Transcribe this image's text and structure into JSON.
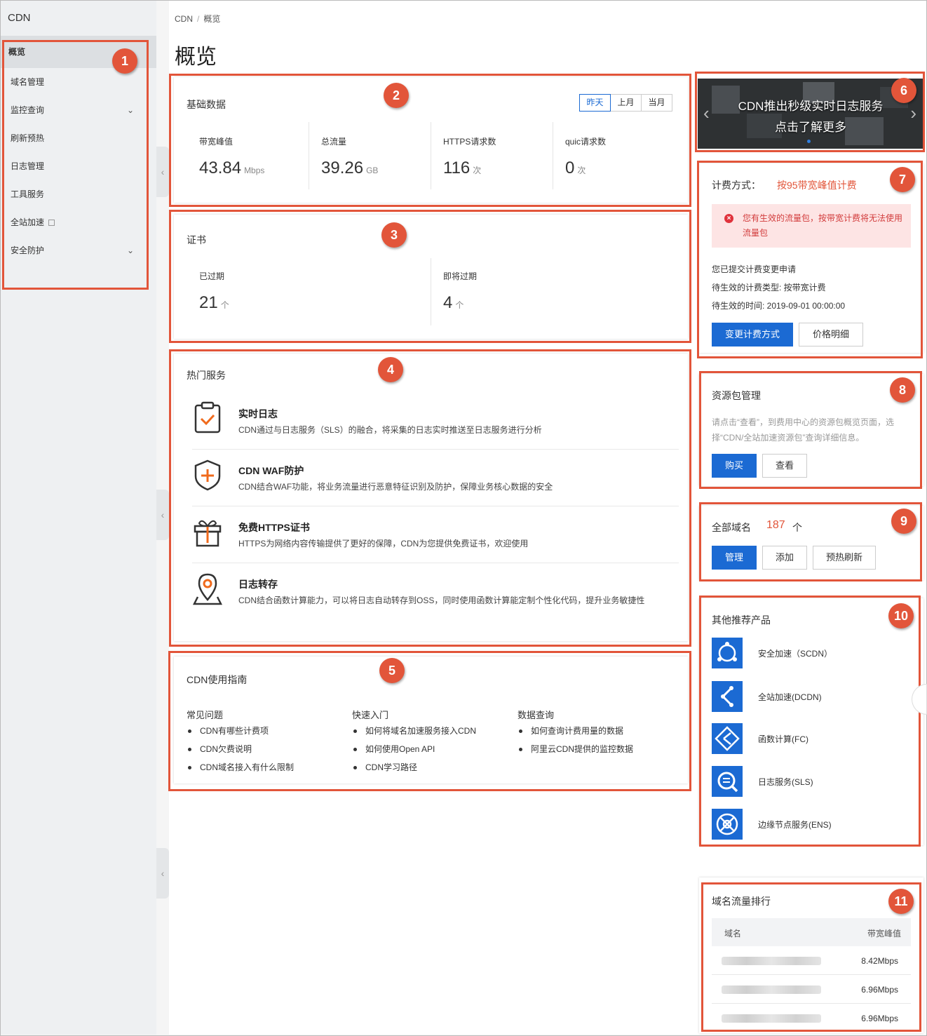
{
  "sidebar": {
    "brand": "CDN",
    "items": [
      {
        "label": "概览"
      },
      {
        "label": "域名管理"
      },
      {
        "label": "监控查询"
      },
      {
        "label": "刷新预热"
      },
      {
        "label": "日志管理"
      },
      {
        "label": "工具服务"
      },
      {
        "label": "全站加速"
      },
      {
        "label": "安全防护"
      }
    ]
  },
  "breadcrumb": {
    "root": "CDN",
    "sep": "/",
    "current": "概览"
  },
  "page_title": "概览",
  "badges": [
    "1",
    "2",
    "3",
    "4",
    "5",
    "6",
    "7",
    "8",
    "9",
    "10",
    "11"
  ],
  "basic": {
    "title": "基础数据",
    "ranges": [
      "昨天",
      "上月",
      "当月"
    ],
    "stats": [
      {
        "label": "带宽峰值",
        "value": "43.84",
        "unit": "Mbps"
      },
      {
        "label": "总流量",
        "value": "39.26",
        "unit": "GB"
      },
      {
        "label": "HTTPS请求数",
        "value": "116",
        "unit": "次"
      },
      {
        "label": "quic请求数",
        "value": "0",
        "unit": "次"
      }
    ]
  },
  "cert": {
    "title": "证书",
    "stats": [
      {
        "label": "已过期",
        "value": "21",
        "unit": "个"
      },
      {
        "label": "即将过期",
        "value": "4",
        "unit": "个"
      }
    ]
  },
  "hot": {
    "title": "热门服务",
    "items": [
      {
        "name": "实时日志",
        "desc": "CDN通过与日志服务（SLS）的融合，将采集的日志实时推送至日志服务进行分析",
        "icon": "clipboard-check-icon"
      },
      {
        "name": "CDN WAF防护",
        "desc": "CDN结合WAF功能，将业务流量进行恶意特征识别及防护，保障业务核心数据的安全",
        "icon": "shield-plus-icon"
      },
      {
        "name": "免费HTTPS证书",
        "desc": "HTTPS为网络内容传输提供了更好的保障，CDN为您提供免费证书，欢迎使用",
        "icon": "gift-icon"
      },
      {
        "name": "日志转存",
        "desc": "CDN结合函数计算能力，可以将日志自动转存到OSS，同时使用函数计算能定制个性化代码，提升业务敏捷性",
        "icon": "location-pin-icon"
      }
    ]
  },
  "guide": {
    "title": "CDN使用指南",
    "columns": [
      {
        "heading": "常见问题",
        "links": [
          "CDN有哪些计费项",
          "CDN欠费说明",
          "CDN域名接入有什么限制"
        ]
      },
      {
        "heading": "快速入门",
        "links": [
          "如何将域名加速服务接入CDN",
          "如何使用Open API",
          "CDN学习路径"
        ]
      },
      {
        "heading": "数据查询",
        "links": [
          "如何查询计费用量的数据",
          "阿里云CDN提供的监控数据"
        ]
      }
    ]
  },
  "banner": {
    "line1": "CDN推出秒级实时日志服务",
    "line2": "点击了解更多"
  },
  "billing": {
    "label": "计费方式：",
    "method": "按95带宽峰值计费",
    "alert": "您有生效的流量包，按带宽计费将无法使用流量包",
    "lines": [
      "您已提交计费变更申请",
      "待生效的计费类型: 按带宽计费",
      "待生效的时间: 2019-09-01 00:00:00"
    ],
    "change_btn": "变更计费方式",
    "price_btn": "价格明细"
  },
  "resource": {
    "title": "资源包管理",
    "desc": "请点击“查看”，到费用中心的资源包概览页面，选择“CDN/全站加速资源包”查询详细信息。",
    "buy_btn": "购买",
    "view_btn": "查看"
  },
  "domains": {
    "label": "全部域名",
    "count": "187",
    "unit": "个",
    "manage_btn": "管理",
    "add_btn": "添加",
    "refresh_btn": "预热刷新"
  },
  "products": {
    "title": "其他推荐产品",
    "items": [
      {
        "name": "安全加速（SCDN）"
      },
      {
        "name": "全站加速(DCDN)"
      },
      {
        "name": "函数计算(FC)"
      },
      {
        "name": "日志服务(SLS)"
      },
      {
        "name": "边缘节点服务(ENS)"
      }
    ]
  },
  "ranking": {
    "title": "域名流量排行",
    "col_domain": "域名",
    "col_bw": "带宽峰值",
    "rows": [
      {
        "bw": "8.42Mbps"
      },
      {
        "bw": "6.96Mbps"
      },
      {
        "bw": "6.96Mbps"
      }
    ]
  },
  "colors": {
    "accent": "#1b6ad3",
    "highlight": "#e2553a",
    "alert_bg": "#fde4e4",
    "alert_text": "#d23c3c"
  }
}
